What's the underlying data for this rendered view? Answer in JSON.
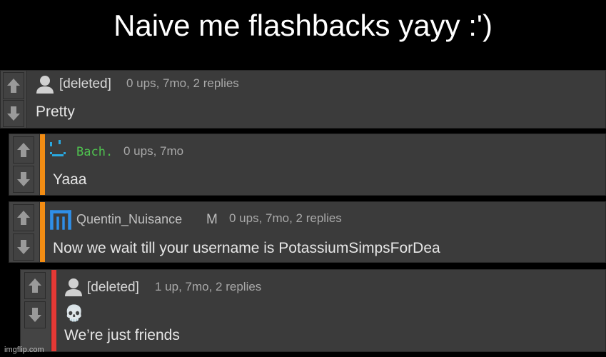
{
  "caption": "Naive me flashbacks yayy :')",
  "comments": [
    {
      "username": "[deleted]",
      "meta": "0 ups, 7mo, 2 replies",
      "body": "Pretty"
    },
    {
      "username": "Bach.",
      "meta": "0 ups, 7mo",
      "body": "Yaaa",
      "stripe_color": "#f28c13",
      "username_color": "#4fc24f"
    },
    {
      "username": "Quentin_Nuisance",
      "mod_badge": "M",
      "meta": "0 ups, 7mo, 2 replies",
      "body": "Now we wait till your username is PotassiumSimpsForDea",
      "stripe_color": "#f28c13"
    },
    {
      "username": "[deleted]",
      "meta": "1 up, 7mo, 2 replies",
      "emoji": "💀",
      "body": "We’re just friends",
      "stripe_color": "#e53935"
    }
  ],
  "watermark": "imgflip.com",
  "colors": {
    "background": "#000000",
    "comment_bg": "#3b3b3b"
  }
}
